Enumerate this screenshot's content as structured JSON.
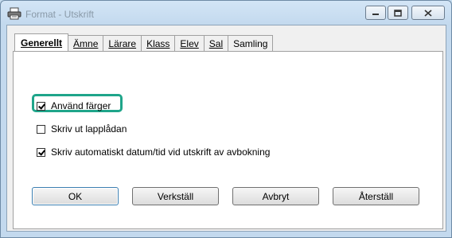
{
  "window": {
    "title": "Format - Utskrift",
    "icons": {
      "app": "printer-icon",
      "minimize": "minimize-icon",
      "maximize": "maximize-icon",
      "close": "close-icon"
    }
  },
  "tabs": [
    {
      "label": "Generellt",
      "active": true
    },
    {
      "label": "Ämne"
    },
    {
      "label": "Lärare"
    },
    {
      "label": "Klass"
    },
    {
      "label": "Elev"
    },
    {
      "label": "Sal"
    },
    {
      "label": "Samling"
    }
  ],
  "options": [
    {
      "label": "Använd färger",
      "checked": true,
      "highlighted": true
    },
    {
      "label": "Skriv ut lapplådan",
      "checked": false
    },
    {
      "label": "Skriv automatiskt datum/tid vid utskrift av avbokning",
      "checked": true
    }
  ],
  "buttons": {
    "ok": "OK",
    "apply": "Verkställ",
    "cancel": "Avbryt",
    "reset": "Återställ"
  },
  "colors": {
    "highlight": "#1fa58a",
    "titlebar": "#c3d9ee"
  }
}
